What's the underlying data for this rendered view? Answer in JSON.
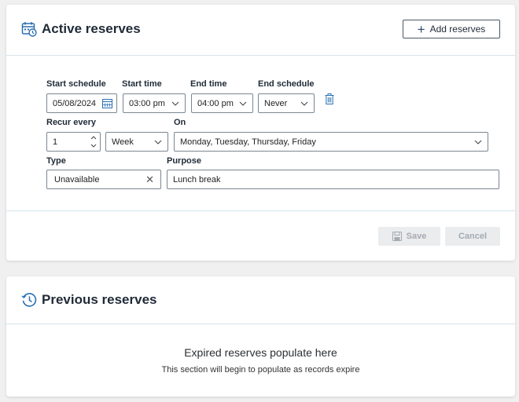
{
  "active": {
    "title": "Active reserves",
    "add_button": "Add reserves",
    "labels": {
      "start_schedule": "Start schedule",
      "start_time": "Start time",
      "end_time": "End time",
      "end_schedule": "End schedule",
      "recur_every": "Recur every",
      "on": "On",
      "type": "Type",
      "purpose": "Purpose"
    },
    "values": {
      "start_schedule": "05/08/2024",
      "start_time": "03:00 pm",
      "end_time": "04:00 pm",
      "end_schedule": "Never",
      "recur_count": "1",
      "recur_unit": "Week",
      "on_days": "Monday, Tuesday, Thursday, Friday",
      "type": "Unavailable",
      "purpose": "Lunch break"
    },
    "save_button": "Save",
    "cancel_button": "Cancel"
  },
  "previous": {
    "title": "Previous reserves",
    "empty_title": "Expired reserves populate here",
    "empty_subtitle": "This section will begin to populate as records expire"
  },
  "colors": {
    "accent": "#2a6fb0",
    "page_bg": "#f0f0f0",
    "divider": "#d6e3ea",
    "disabled_button_bg": "#eaecee",
    "disabled_button_text": "#a4abb2"
  },
  "icons": {
    "active_title": "calendar-clock-icon",
    "add": "plus-icon",
    "date": "calendar-icon",
    "dropdown": "chevron-down-icon",
    "delete": "trash-icon",
    "spinner": "spinner-arrows-icon",
    "clear": "close-icon",
    "save": "floppy-disk-icon",
    "previous_title": "history-icon"
  }
}
